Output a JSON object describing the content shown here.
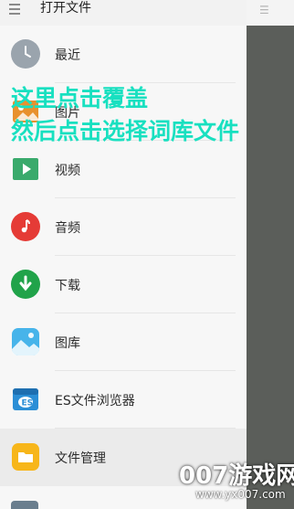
{
  "header": {
    "title": "打开文件"
  },
  "drawer": {
    "items": [
      {
        "label": "最近",
        "icon": "clock-icon",
        "color": "#9aa4ad"
      },
      {
        "label": "图片",
        "icon": "image-icon",
        "color": "#e8912e"
      },
      {
        "label": "视频",
        "icon": "video-icon",
        "color": "#3aaa6c"
      },
      {
        "label": "音频",
        "icon": "music-icon",
        "color": "#e53b36"
      },
      {
        "label": "下载",
        "icon": "download-icon",
        "color": "#21a34a"
      },
      {
        "label": "图库",
        "icon": "gallery-icon",
        "color": "#47b4ea"
      },
      {
        "label": "ES文件浏览器",
        "icon": "es-explorer-icon",
        "color": "#2c8fd6"
      },
      {
        "label": "文件管理",
        "icon": "folder-icon",
        "color": "#f7b61a",
        "selected": true
      }
    ]
  },
  "overlay": {
    "line1": "这里点击覆盖",
    "line2": "然后点击选择词库文件"
  },
  "watermark": {
    "main": "007游戏网",
    "sub": "www.yx007.com"
  },
  "colors": {
    "overlay_text": "#18e0c0",
    "scrim": "#5a5d59",
    "drawer_bg": "#f7f7f7"
  }
}
